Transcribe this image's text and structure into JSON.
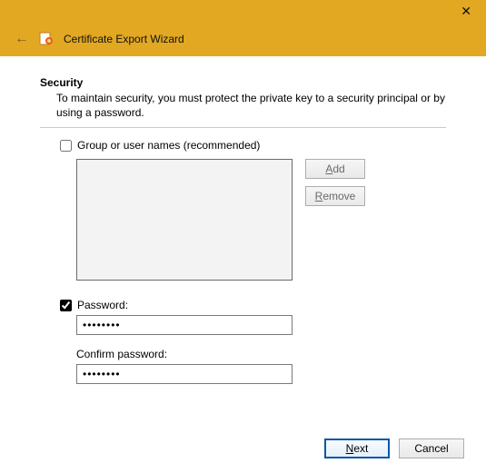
{
  "window": {
    "title": "Certificate Export Wizard"
  },
  "section": {
    "heading": "Security",
    "description": "To maintain security, you must protect the private key to a security principal or by using a password."
  },
  "group": {
    "checkbox_label": "Group or user names (recommended)",
    "checked": false,
    "add_label_pre": "",
    "add_label_u": "A",
    "add_label_post": "dd",
    "remove_label_pre": "",
    "remove_label_u": "R",
    "remove_label_post": "emove"
  },
  "password": {
    "checkbox_label": "Password:",
    "checked": true,
    "value": "••••••••",
    "confirm_label": "Confirm password:",
    "confirm_value": "••••••••"
  },
  "footer": {
    "next_pre": "",
    "next_u": "N",
    "next_post": "ext",
    "cancel": "Cancel"
  }
}
